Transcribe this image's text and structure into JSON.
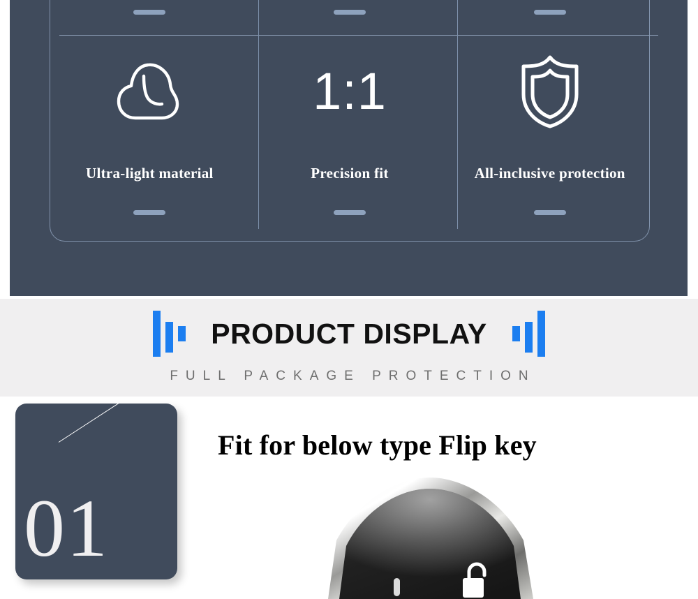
{
  "features": {
    "columns": [
      {
        "icon": "feather-cloud-icon",
        "label": "Ultra-light material",
        "dash_top": "",
        "dash_bottom": ""
      },
      {
        "icon": "ratio-1-1-text",
        "label": "Precision fit",
        "value": "1:1"
      },
      {
        "icon": "shield-icon",
        "label": "All-inclusive protection"
      }
    ],
    "panel_color": "#404b5c",
    "accent_line_color": "#8ea2bd"
  },
  "banner": {
    "title": "PRODUCT DISPLAY",
    "subtitle": "FULL PACKAGE PROTECTION",
    "bar_color": "#1c7ef0",
    "background": "#f0eff0"
  },
  "display": {
    "number": "01",
    "heading": "Fit for below type Flip key",
    "card_color": "#404b5c",
    "product": "black-flip-key-fob"
  }
}
